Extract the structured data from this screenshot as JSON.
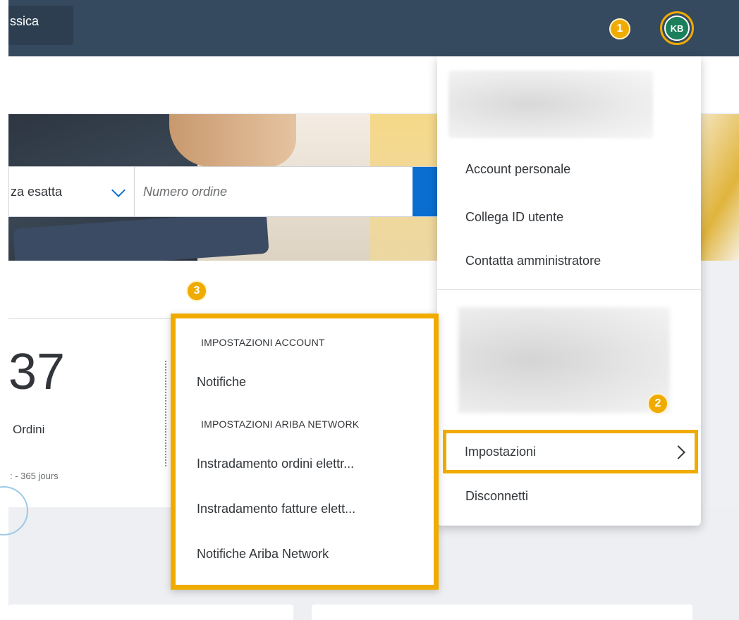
{
  "topbar": {
    "app_tab_label": "ssica",
    "avatar_initials": "KB"
  },
  "callouts": {
    "one": "1",
    "two": "2",
    "three": "3"
  },
  "search": {
    "select_value": "za esatta",
    "placeholder": "Numero ordine"
  },
  "tile": {
    "number": "37",
    "label": "Ordini",
    "sublabel": ": - 365 jours"
  },
  "user_menu": {
    "items": [
      {
        "label": "Account personale"
      },
      {
        "label": "Collega ID utente"
      },
      {
        "label": "Contatta amministratore"
      }
    ],
    "settings_label": "Impostazioni",
    "logout_label": "Disconnetti"
  },
  "settings_submenu": {
    "account_header": "IMPOSTAZIONI ACCOUNT",
    "notifications": "Notifiche",
    "network_header": "IMPOSTAZIONI ARIBA NETWORK",
    "order_routing": "Instradamento ordini elettr...",
    "invoice_routing": "Instradamento fatture elett...",
    "network_notifications": "Notifiche Ariba Network"
  },
  "colors": {
    "topbar": "#354a5f",
    "highlight": "#f0ab00",
    "accent": "#0a6ed1",
    "avatar": "#1a7f5a"
  }
}
